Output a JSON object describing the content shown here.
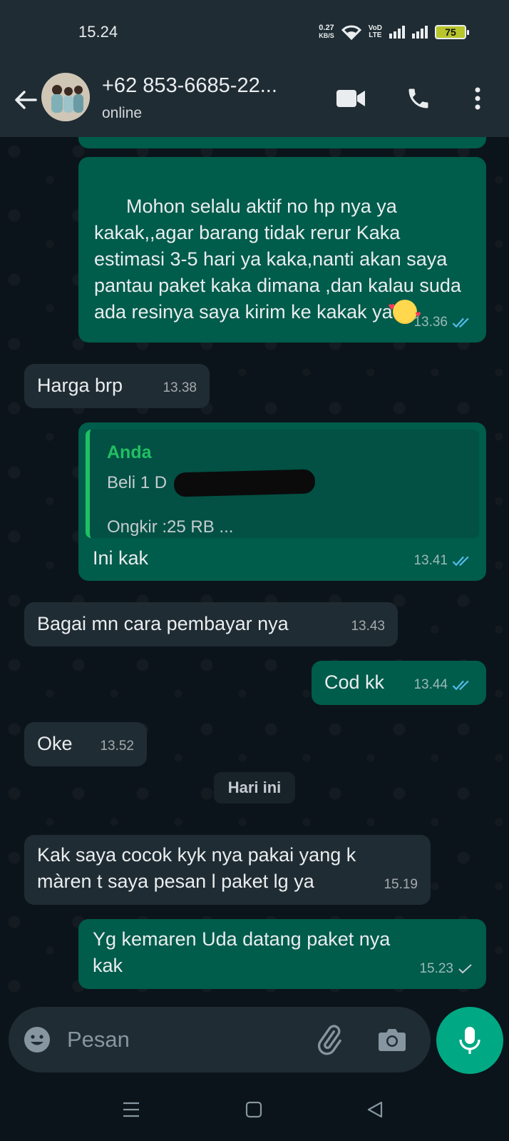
{
  "status_bar": {
    "time": "15.24",
    "net_speed_value": "0.27",
    "net_speed_unit": "KB/S",
    "volte_top": "VoD",
    "volte_bottom": "LTE",
    "battery": "75"
  },
  "header": {
    "contact_name": "+62 853-6685-22...",
    "contact_status": "online",
    "icons": [
      "back-arrow-icon",
      "video-call-icon",
      "voice-call-icon",
      "more-vert-icon"
    ]
  },
  "messages": [
    {
      "id": "m0",
      "direction": "out",
      "text": "",
      "time": "13.36",
      "status": "read"
    },
    {
      "id": "m1",
      "direction": "out",
      "text": "Mohon selalu aktif no hp nya ya kakak,,agar barang tidak rerur Kaka estimasi 3-5 hari ya kaka,nanti akan saya pantau paket kaka dimana ,dan kalau suda ada resinya saya kirim ke kakak ya",
      "time": "13.36",
      "status": "read",
      "emoji": "smiling-face-with-hearts"
    },
    {
      "id": "m2",
      "direction": "in",
      "text": "Harga brp",
      "time": "13.38"
    },
    {
      "id": "m3",
      "direction": "out",
      "quote": {
        "author": "Anda",
        "line1": "Beli 1 D",
        "line2": "Ongkir :25 RB ..."
      },
      "text": "Ini kak",
      "time": "13.41",
      "status": "read"
    },
    {
      "id": "m4",
      "direction": "in",
      "text": "Bagai mn cara pembayar nya",
      "time": "13.43"
    },
    {
      "id": "m5",
      "direction": "out",
      "text": "Cod kk",
      "time": "13.44",
      "status": "read"
    },
    {
      "id": "m6",
      "direction": "in",
      "text": "Oke",
      "time": "13.52"
    },
    {
      "id": "m7",
      "direction": "in",
      "text": "Kak saya cocok kyk nya pakai yang k\nmàren t saya pesan l paket lg ya",
      "time": "15.19"
    },
    {
      "id": "m8",
      "direction": "out",
      "text": "Yg kemaren Uda datang paket nya\nkak",
      "time": "15.23",
      "status": "sent"
    }
  ],
  "date_divider": "Hari ini",
  "composer": {
    "placeholder": "Pesan"
  },
  "colors": {
    "outgoing_bubble": "#005c4b",
    "incoming_bubble": "#202c33",
    "background": "#0b141a",
    "accent": "#00a884",
    "read_tick": "#53bdeb"
  }
}
